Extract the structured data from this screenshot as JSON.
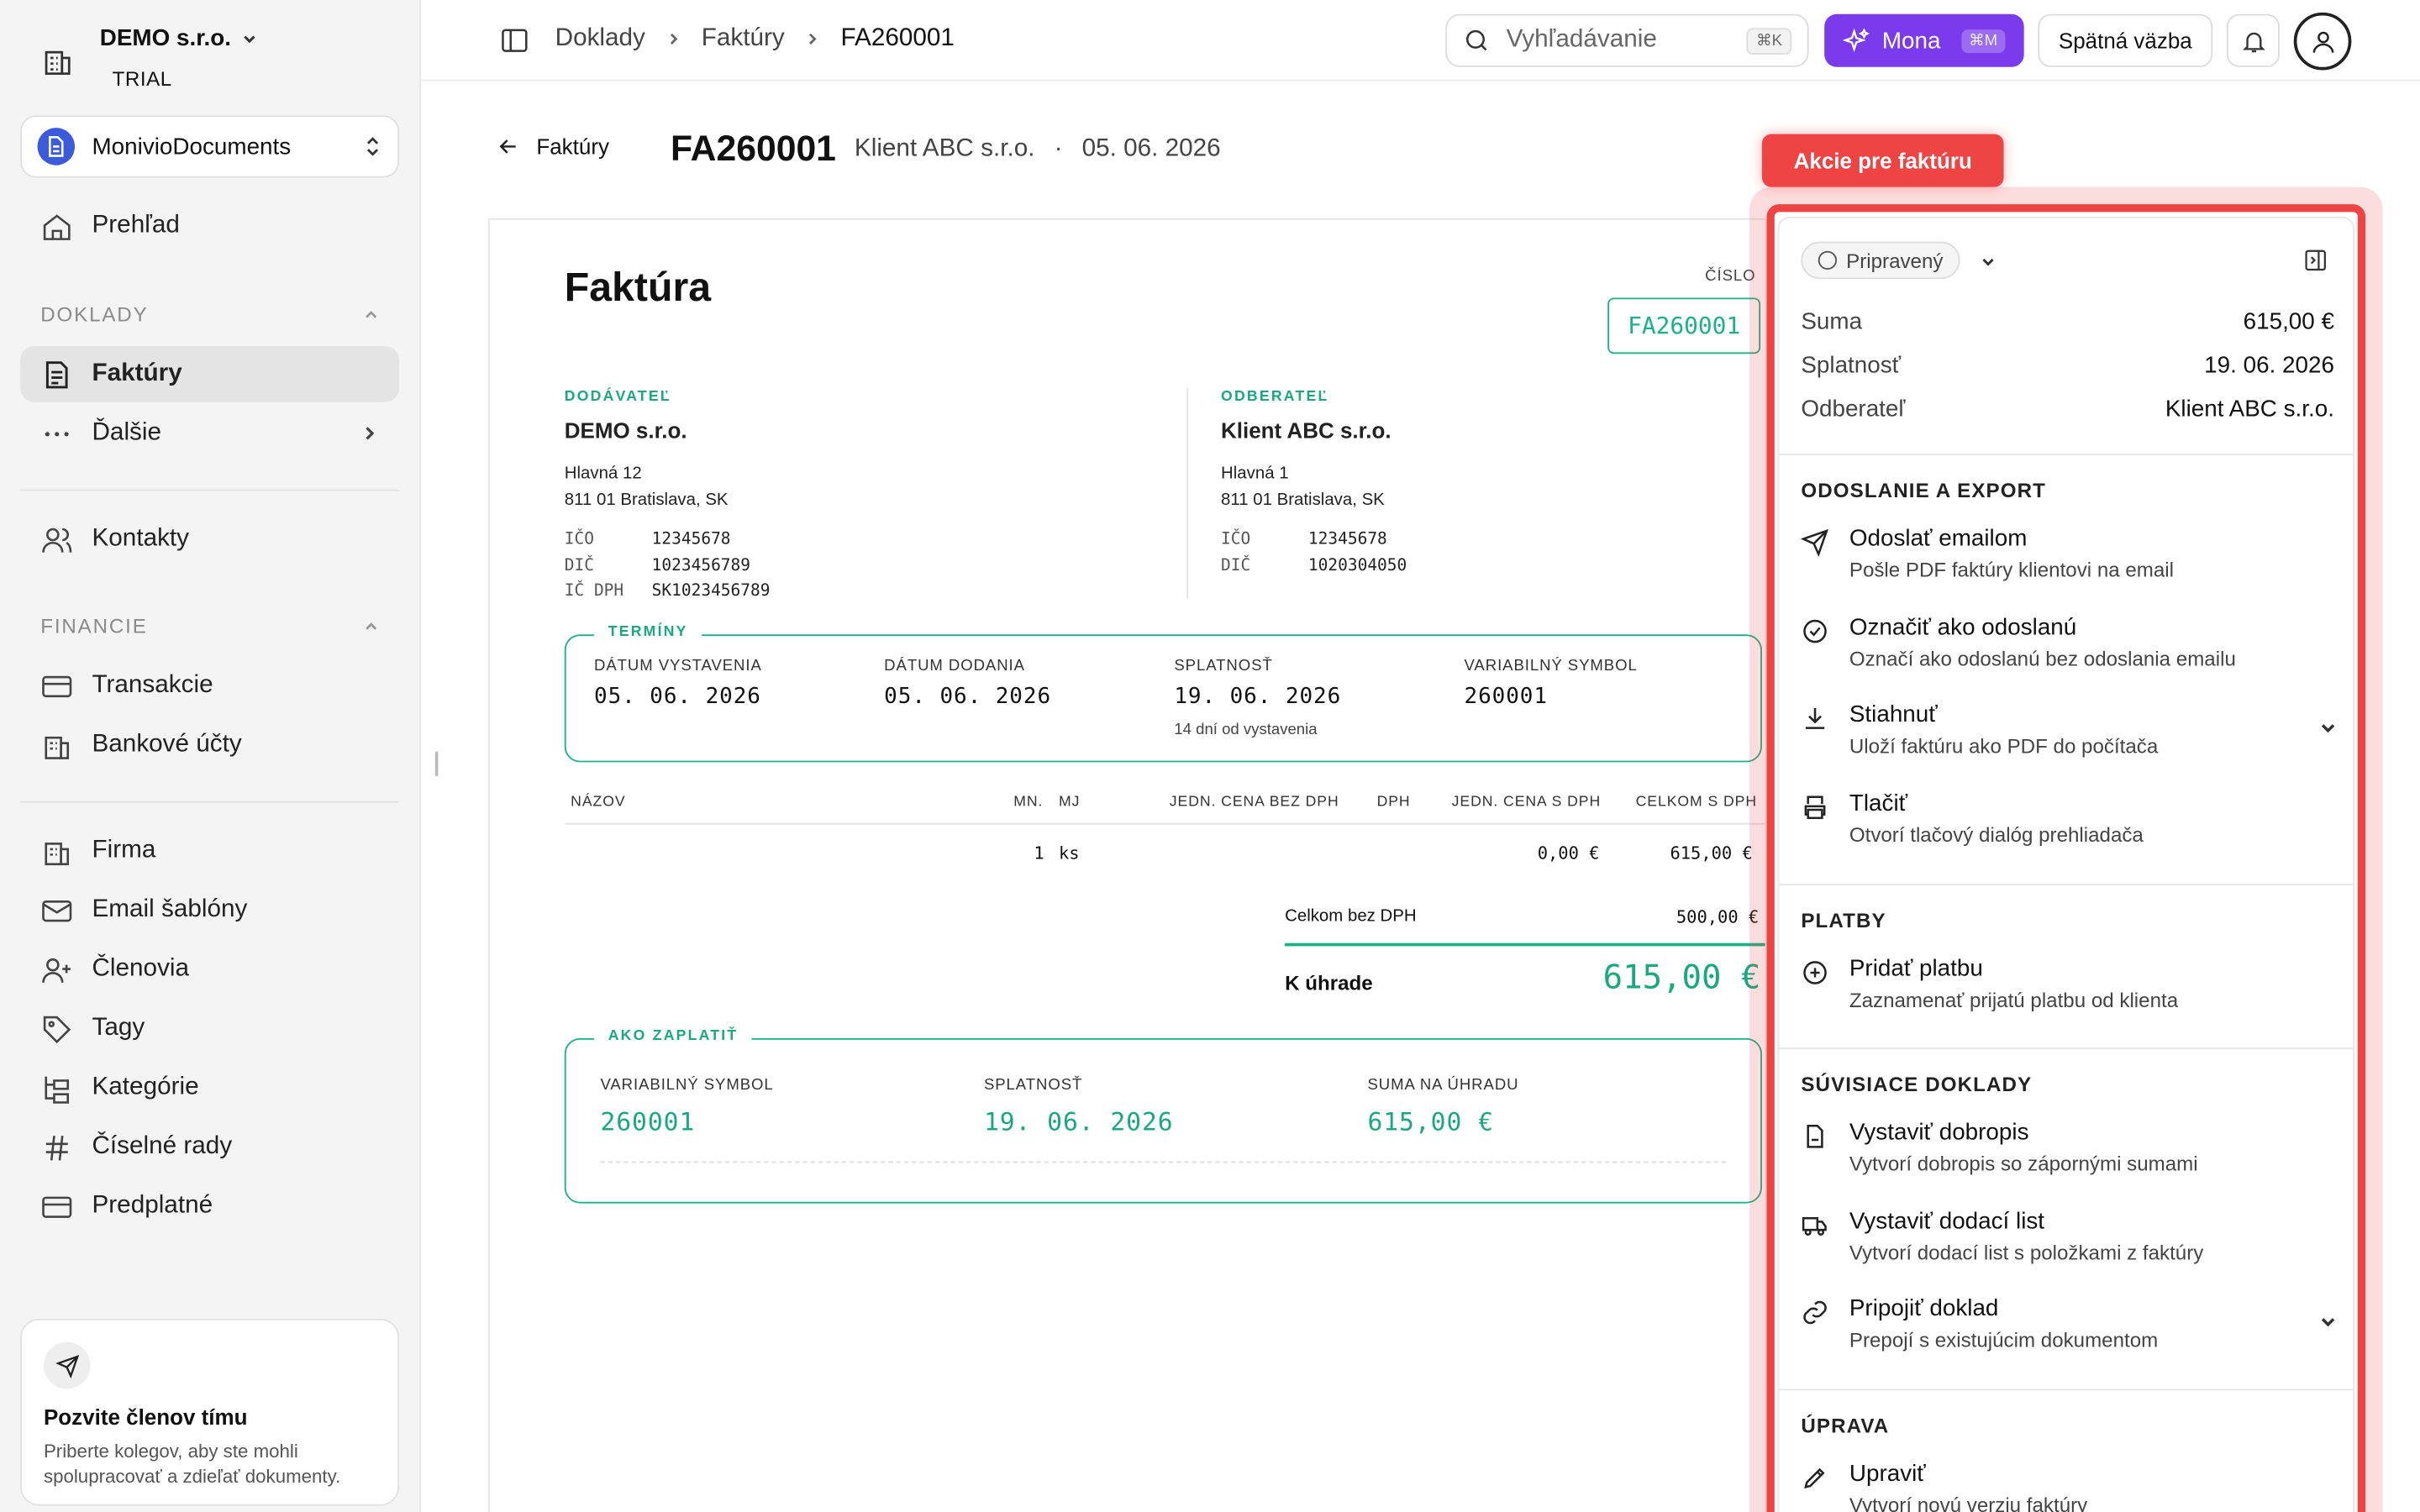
{
  "org": {
    "name": "DEMO s.r.o.",
    "plan": "TRIAL"
  },
  "workspace": {
    "name": "MonivioDocuments"
  },
  "nav": {
    "overview": "Prehľad",
    "section_docs": "DOKLADY",
    "invoices": "Faktúry",
    "more": "Ďalšie",
    "contacts": "Kontakty",
    "section_finance": "FINANCIE",
    "transactions": "Transakcie",
    "bank_accounts": "Bankové účty",
    "company": "Firma",
    "email_templates": "Email šablóny",
    "members": "Členovia",
    "tags": "Tagy",
    "categories": "Kategórie",
    "number_series": "Číselné rady",
    "subscription": "Predplatné"
  },
  "invite": {
    "title": "Pozvite členov tímu",
    "text": "Priberte kolegov, aby ste mohli spolupracovať a zdieľať dokumenty."
  },
  "topbar": {
    "breadcrumbs": [
      "Doklady",
      "Faktúry",
      "FA260001"
    ],
    "search_placeholder": "Vyhľadávanie",
    "search_kbd": "⌘K",
    "mona_label": "Mona",
    "mona_kbd": "⌘M",
    "feedback_label": "Spätná väzba"
  },
  "header": {
    "back_label": "Faktúry",
    "doc_number": "FA260001",
    "client": "Klient ABC s.r.o.",
    "separator": "·",
    "date": "05. 06. 2026"
  },
  "invoice": {
    "title": "Faktúra",
    "number_label": "ČÍSLO",
    "number": "FA260001",
    "supplier": {
      "label": "DODÁVATEĽ",
      "name": "DEMO s.r.o.",
      "street": "Hlavná 12",
      "city": "811 01 Bratislava, SK",
      "ico_label": "IČO",
      "ico": "12345678",
      "dic_label": "DIČ",
      "dic": "1023456789",
      "icdph_label": "IČ DPH",
      "icdph": "SK1023456789"
    },
    "customer": {
      "label": "ODBERATEĽ",
      "name": "Klient ABC s.r.o.",
      "street": "Hlavná 1",
      "city": "811 01 Bratislava, SK",
      "ico_label": "IČO",
      "ico": "12345678",
      "dic_label": "DIČ",
      "dic": "1020304050"
    },
    "terms": {
      "legend": "TERMÍNY",
      "issue_label": "DÁTUM VYSTAVENIA",
      "issue": "05. 06. 2026",
      "delivery_label": "DÁTUM DODANIA",
      "delivery": "05. 06. 2026",
      "due_label": "SPLATNOSŤ",
      "due": "19. 06. 2026",
      "due_note": "14 dní od vystavenia",
      "vs_label": "VARIABILNÝ SYMBOL",
      "vs": "260001"
    },
    "table": {
      "headers": [
        "NÁZOV",
        "MN.",
        "MJ",
        "JEDN. CENA BEZ DPH",
        "DPH",
        "JEDN. CENA S DPH",
        "CELKOM S DPH"
      ],
      "rows": [
        {
          "qty": "1",
          "unit": "ks",
          "unit_price_vat": "0,00 €",
          "total": "615,00 €"
        }
      ]
    },
    "totals": {
      "net_label": "Celkom bez DPH",
      "net": "500,00 €",
      "due_label": "K úhrade",
      "due": "615,00 €"
    },
    "payment": {
      "legend": "AKO ZAPLATIŤ",
      "vs_label": "VARIABILNÝ SYMBOL",
      "vs": "260001",
      "due_label": "SPLATNOSŤ",
      "due": "19. 06. 2026",
      "amount_label": "SUMA NA ÚHRADU",
      "amount": "615,00 €"
    }
  },
  "annotation": {
    "label": "Akcie pre faktúru",
    "color": "#ef4444"
  },
  "panel": {
    "status": "Pripravený",
    "summary": [
      {
        "label": "Suma",
        "value": "615,00 €"
      },
      {
        "label": "Splatnosť",
        "value": "19. 06. 2026"
      },
      {
        "label": "Odberateľ",
        "value": "Klient ABC s.r.o."
      }
    ],
    "sections": {
      "send": "ODOSLANIE A EXPORT",
      "payments": "PLATBY",
      "related": "SÚVISIACE DOKLADY",
      "edit": "ÚPRAVA"
    },
    "actions": {
      "email": {
        "title": "Odoslať emailom",
        "desc": "Pošle PDF faktúry klientovi na email"
      },
      "mark_sent": {
        "title": "Označiť ako odoslanú",
        "desc": "Označí ako odoslanú bez odoslania emailu"
      },
      "download": {
        "title": "Stiahnuť",
        "desc": "Uloží faktúru ako PDF do počítača"
      },
      "print": {
        "title": "Tlačiť",
        "desc": "Otvorí tlačový dialóg prehliadača"
      },
      "add_payment": {
        "title": "Pridať platbu",
        "desc": "Zaznamenať prijatú platbu od klienta"
      },
      "credit_note": {
        "title": "Vystaviť dobropis",
        "desc": "Vytvorí dobropis so zápornými sumami"
      },
      "delivery_note": {
        "title": "Vystaviť dodací list",
        "desc": "Vytvorí dodací list s položkami z faktúry"
      },
      "attach_doc": {
        "title": "Pripojiť doklad",
        "desc": "Prepojí s existujúcim dokumentom"
      },
      "edit": {
        "title": "Upraviť",
        "desc": "Vytvorí novú verziu faktúry"
      }
    }
  },
  "colors": {
    "accent_green": "#19b386",
    "mona_purple": "#7c3aed",
    "annotation_red": "#ef4444"
  }
}
